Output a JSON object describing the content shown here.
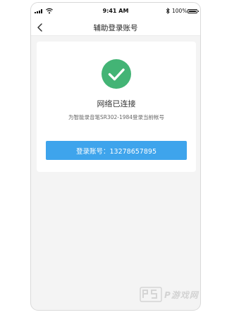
{
  "status_bar": {
    "time": "9:41 AM",
    "battery": "100%",
    "battery_level": 1.0,
    "icons": [
      "signal-icon",
      "wifi-icon",
      "bluetooth-icon",
      "battery-icon"
    ]
  },
  "nav": {
    "back_icon": "chevron-left-icon",
    "title": "辅助登录账号"
  },
  "card": {
    "status_icon": "check-circle-icon",
    "status_title": "网络已连接",
    "description": "为智能录音笔SR302-1984登录当前帐号",
    "login_button": "登录账号：13278657895"
  },
  "watermark": {
    "text": "P游戏网"
  },
  "colors": {
    "success": "#43b475",
    "primary_button": "#3ea4ec",
    "background": "#f4f4f4"
  }
}
